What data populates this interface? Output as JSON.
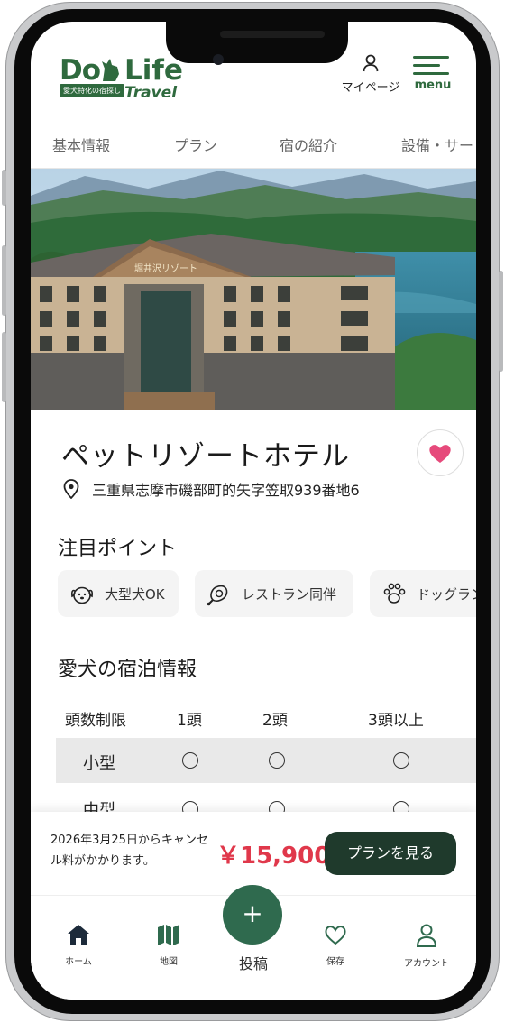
{
  "header": {
    "logo_do": "Do",
    "logo_life": "Life",
    "logo_tagline": "愛犬特化の宿探し",
    "logo_travel": "Travel",
    "mypage_label": "マイページ",
    "menu_label": "menu"
  },
  "tabs": [
    {
      "label": "基本情報"
    },
    {
      "label": "プラン"
    },
    {
      "label": "宿の紹介"
    },
    {
      "label": "設備・サービス"
    }
  ],
  "hero": {
    "building_sign": "堀井沢リゾート"
  },
  "hotel": {
    "name": "ペットリゾートホテル",
    "address": "三重県志摩市磯部町的矢字笠取939番地6",
    "favorited": true
  },
  "highlights": {
    "title": "注目ポイント",
    "items": [
      {
        "label": "大型犬OK",
        "icon": "dog-face-icon"
      },
      {
        "label": "レストラン同伴",
        "icon": "meat-icon"
      },
      {
        "label": "ドッグラン",
        "icon": "paw-icon"
      }
    ]
  },
  "stay_info": {
    "title": "愛犬の宿泊情報",
    "headers": [
      "頭数制限",
      "1頭",
      "2頭",
      "3頭以上"
    ],
    "rows": [
      {
        "size": "小型",
        "values": [
          "○",
          "○",
          "○"
        ]
      },
      {
        "size": "中型",
        "values": [
          "○",
          "○",
          "○"
        ]
      }
    ]
  },
  "booking": {
    "cancel_note": "2026年3月25日からキャンセル料がかかります。",
    "price": "￥15,900",
    "plan_button": "プランを見る"
  },
  "bottom_nav": {
    "items": [
      {
        "label": "ホーム",
        "icon": "home-icon"
      },
      {
        "label": "地図",
        "icon": "map-icon"
      },
      {
        "label": "保存",
        "icon": "heart-icon"
      },
      {
        "label": "アカウント",
        "icon": "account-icon"
      }
    ],
    "post_symbol": "+",
    "post_label": "投稿"
  },
  "colors": {
    "brand_green": "#2f6a3e",
    "dark_green": "#1f3a2c",
    "price_red": "#e0384b",
    "heart_pink": "#e64a7b"
  }
}
